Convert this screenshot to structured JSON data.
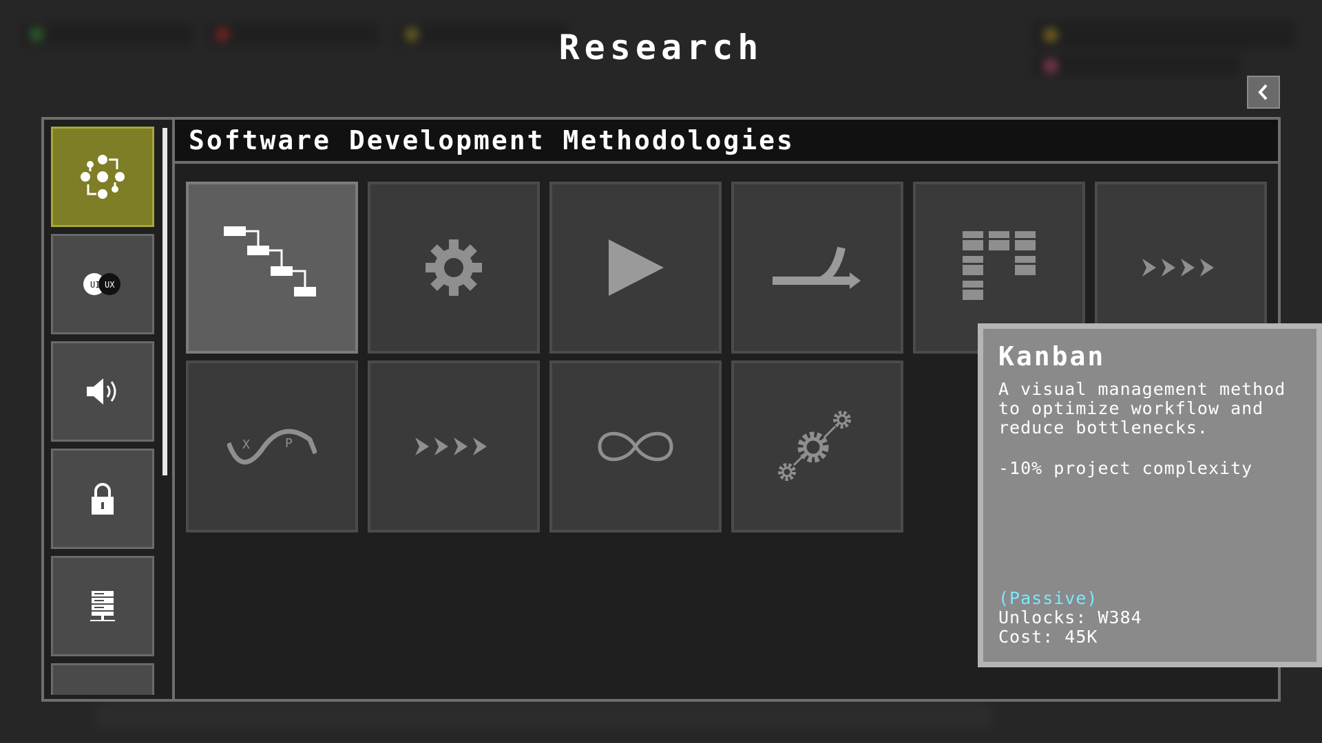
{
  "screen": {
    "title": "Research"
  },
  "category": {
    "title": "Software Development Methodologies"
  },
  "sidebar": {
    "items": [
      {
        "icon": "gear-cycle-icon",
        "active": true
      },
      {
        "icon": "ui-ux-icon",
        "label_ui": "UI",
        "label_ux": "UX",
        "active": false
      },
      {
        "icon": "speaker-icon",
        "active": false
      },
      {
        "icon": "lock-icon",
        "active": false
      },
      {
        "icon": "server-icon",
        "active": false
      },
      {
        "icon": "partial-item",
        "active": false
      }
    ]
  },
  "tiles": [
    {
      "icon": "waterfall-icon",
      "selected": true
    },
    {
      "icon": "gear-icon",
      "selected": false
    },
    {
      "icon": "play-icon",
      "selected": false
    },
    {
      "icon": "branch-arrow-icon",
      "selected": false
    },
    {
      "icon": "kanban-board-icon",
      "selected": false
    },
    {
      "icon": "chevrons-right-icon",
      "selected": false
    },
    {
      "icon": "xp-wave-icon",
      "label_x": "X",
      "label_p": "P",
      "selected": false
    },
    {
      "icon": "chevrons-right-icon",
      "selected": false
    },
    {
      "icon": "infinity-icon",
      "selected": false
    },
    {
      "icon": "gears-cluster-icon",
      "selected": false
    }
  ],
  "tooltip": {
    "title": "Kanban",
    "description": "A visual management method to optimize workflow and reduce bottlenecks.",
    "effect": "-10% project complexity",
    "type": "(Passive)",
    "unlocks": "Unlocks: W384",
    "cost": "Cost: 45K"
  },
  "colors": {
    "active_category": "#7d7e26",
    "tooltip_bg": "#8a8a8a",
    "passive_text": "#7fe7ff"
  }
}
